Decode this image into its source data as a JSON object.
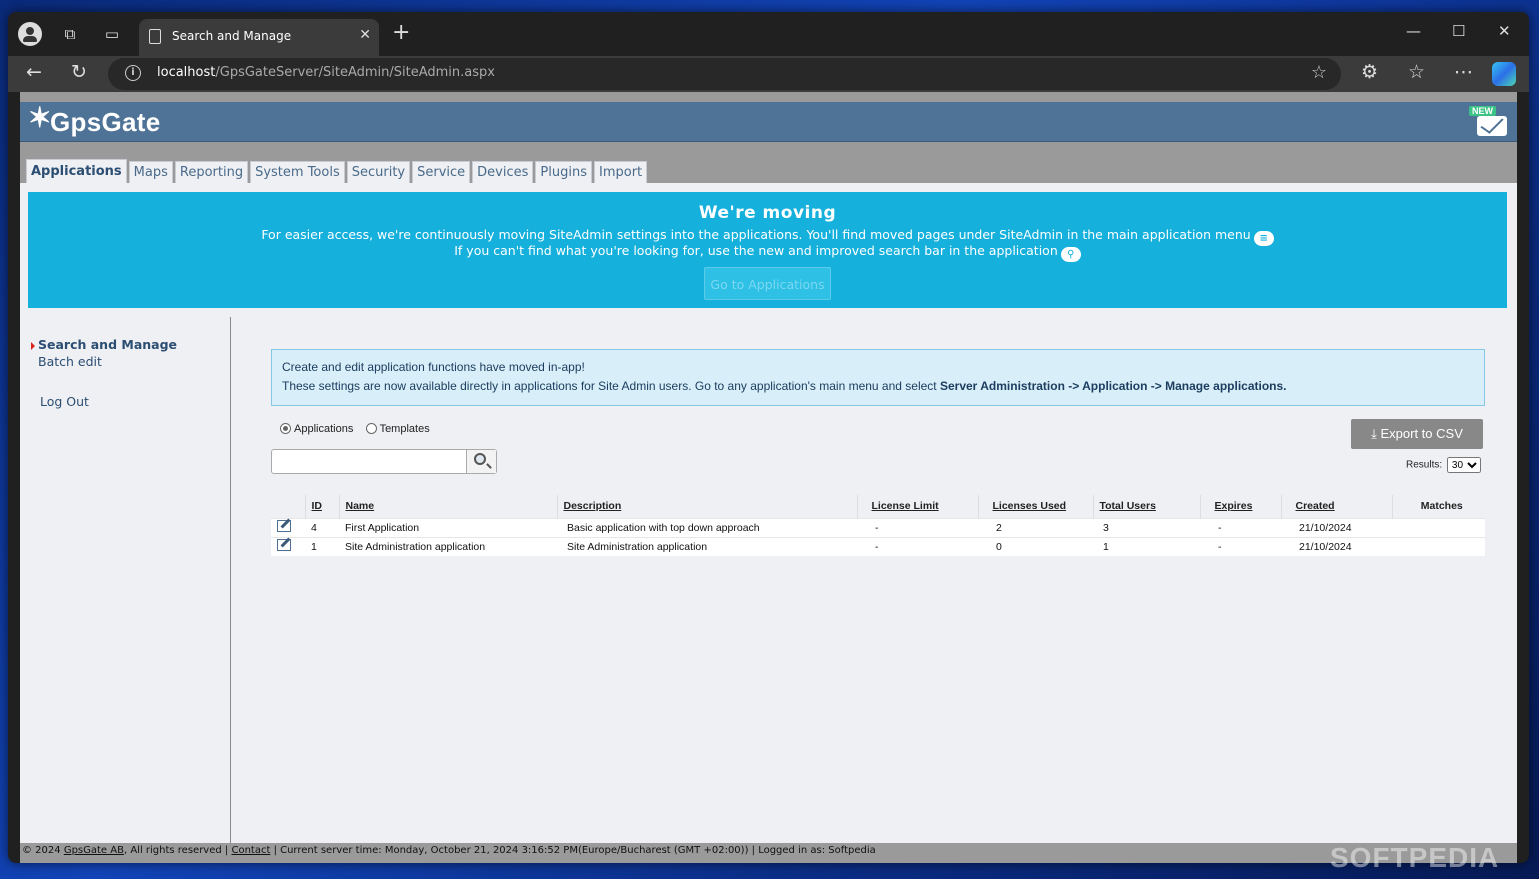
{
  "browser": {
    "tab_title": "Search and Manage",
    "url_host": "localhost",
    "url_path": "/GpsGateServer/SiteAdmin/SiteAdmin.aspx"
  },
  "app": {
    "logo_text": "GpsGate",
    "mail_badge": "NEW"
  },
  "main_tabs": [
    "Applications",
    "Maps",
    "Reporting",
    "System Tools",
    "Security",
    "Service",
    "Devices",
    "Plugins",
    "Import"
  ],
  "banner": {
    "title": "We're moving",
    "line1": "For easier access, we're continuously moving SiteAdmin settings into the applications. You'll find moved pages under SiteAdmin in the main application menu",
    "line2": "If you can't find what you're looking for, use the new and improved search bar in the application",
    "button": "Go to Applications",
    "color": "#15b0dc"
  },
  "sidebar": {
    "items": [
      "Search and Manage",
      "Batch edit",
      "Log Out"
    ]
  },
  "notice": {
    "line1": "Create and edit application functions have moved in-app!",
    "line2": "These settings are now available directly in applications for Site Admin users. Go to any application's main menu and select",
    "line2_bold": "Server Administration -> Application -> Manage applications."
  },
  "filters": {
    "radio_applications": "Applications",
    "radio_templates": "Templates",
    "selected": "Applications",
    "search_value": ""
  },
  "export_button": "Export to CSV",
  "results": {
    "label": "Results:",
    "value": "30"
  },
  "table": {
    "headers": [
      "ID",
      "Name",
      "Description",
      "License Limit",
      "Licenses Used",
      "Total Users",
      "Expires",
      "Created",
      "Matches"
    ],
    "rows": [
      [
        "4",
        "First Application",
        "Basic application with top down approach",
        "-",
        "2",
        "3",
        "-",
        "21/10/2024",
        ""
      ],
      [
        "1",
        "Site Administration application",
        "Site Administration application",
        "-",
        "0",
        "1",
        "-",
        "21/10/2024",
        ""
      ]
    ]
  },
  "footer": {
    "prefix": "© 2024",
    "company": "GpsGate AB",
    "rights": ", All rights reserved |",
    "contact": "Contact",
    "rest": "| Current server time: Monday, October 21, 2024 3:16:52 PM(Europe/Bucharest (GMT +02:00)) | Logged in as: Softpedia"
  },
  "watermark": "SOFTPEDIA"
}
